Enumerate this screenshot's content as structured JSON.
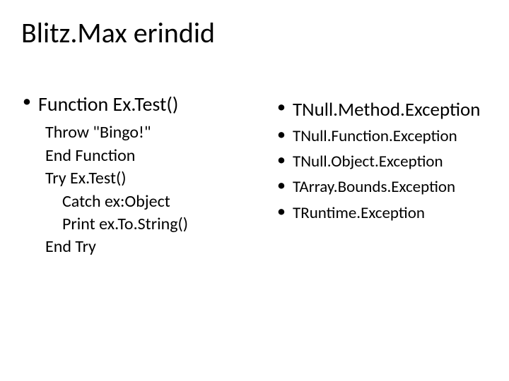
{
  "title": "Blitz.Max erindid",
  "left": {
    "heading": "Function Ex.Test()",
    "lines": [
      "Throw \"Bingo!\"",
      "End Function",
      "Try Ex.Test()",
      "Catch ex:Object",
      "Print ex.To.String()",
      "End Try"
    ]
  },
  "right": {
    "heading": "TNull.Method.Exception",
    "items": [
      "TNull.Function.Exception",
      "TNull.Object.Exception",
      "TArray.Bounds.Exception",
      "TRuntime.Exception"
    ]
  }
}
